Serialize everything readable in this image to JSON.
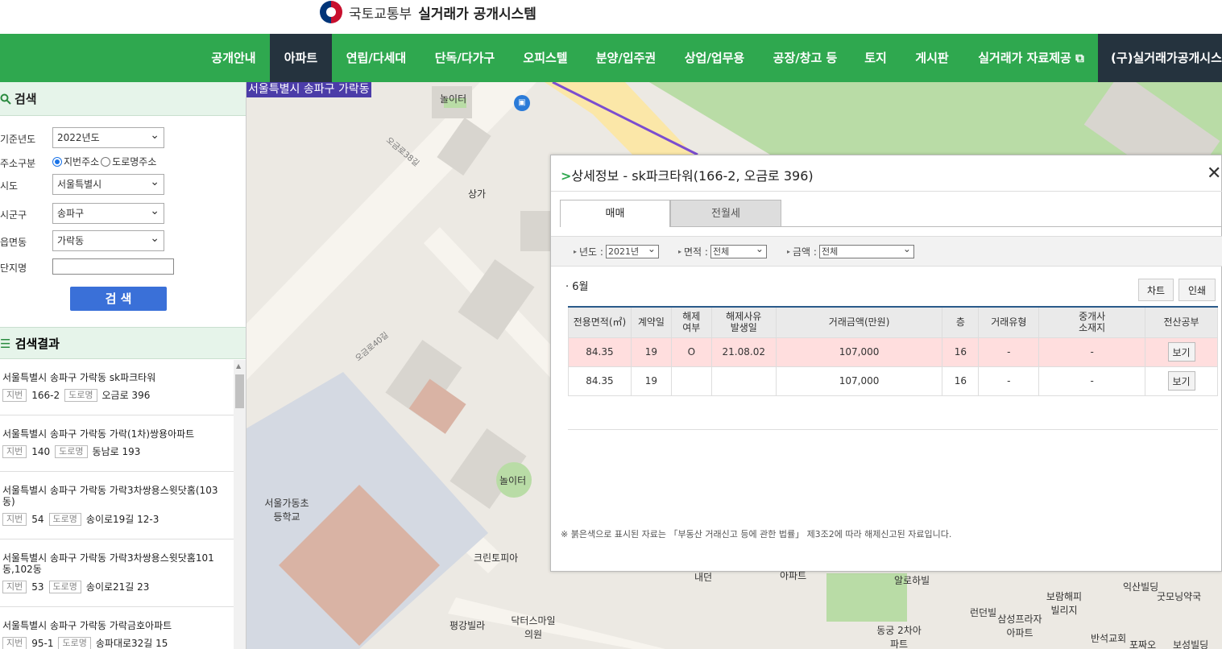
{
  "header": {
    "org": "국토교통부",
    "system": "실거래가 공개시스템"
  },
  "nav": {
    "items": [
      "공개안내",
      "아파트",
      "연립/다세대",
      "단독/다가구",
      "오피스텔",
      "분양/입주권",
      "상업/업무용",
      "공장/창고 등",
      "토지",
      "게시판",
      "실거래가 자료제공 ⧉",
      "(구)실거래가공개시스"
    ],
    "active": "아파트"
  },
  "sidebar": {
    "search_title": "검색",
    "fields": {
      "year_label": "기준년도",
      "year_value": "2022년도",
      "addr_type_label": "주소구분",
      "addr_opt1": "지번주소",
      "addr_opt2": "도로명주소",
      "sido_label": "시도",
      "sido_value": "서울특별시",
      "sigungu_label": "시군구",
      "sigungu_value": "송파구",
      "dong_label": "읍면동",
      "dong_value": "가락동",
      "complex_label": "단지명",
      "complex_value": ""
    },
    "search_button": "검 색",
    "results_title": "검색결과",
    "results": [
      {
        "name": "서울특별시 송파구 가락동 sk파크타워",
        "jibun_tag": "지번",
        "jibun": "166-2",
        "road_tag": "도로명",
        "road": "오금로 396"
      },
      {
        "name": "서울특별시 송파구 가락동 가락(1차)쌍용아파트",
        "jibun_tag": "지번",
        "jibun": "140",
        "road_tag": "도로명",
        "road": "동남로 193"
      },
      {
        "name": "서울특별시 송파구 가락동 가락3차쌍용스윗닷홈(103동)",
        "jibun_tag": "지번",
        "jibun": "54",
        "road_tag": "도로명",
        "road": "송이로19길 12-3"
      },
      {
        "name": "서울특별시 송파구 가락동 가락3차쌍용스윗닷홈101동,102동",
        "jibun_tag": "지번",
        "jibun": "53",
        "road_tag": "도로명",
        "road": "송이로21길 23"
      },
      {
        "name": "서울특별시 송파구 가락동 가락금호아파트",
        "jibun_tag": "지번",
        "jibun": "95-1",
        "road_tag": "도로명",
        "road": "송파대로32길 15"
      }
    ]
  },
  "map": {
    "address_overlay": "서울특별시 송파구 가락동",
    "labels": [
      "놀이터",
      "상가",
      "오금로38길",
      "오금로40길",
      "서울가동초등학교",
      "놀이터",
      "크린토피아",
      "평강빌라",
      "닥터스마일의원",
      "알로하빌",
      "런던빌",
      "삼성프라자아파트",
      "보람해피빌리지",
      "익산빌딩",
      "굿모닝약국",
      "반석교회",
      "포짜오",
      "보성빌딩",
      "내던",
      "아파트",
      "동궁 2차아파트"
    ]
  },
  "detail": {
    "title": "상세정보 - sk파크타워(166-2, 오금로 396)",
    "tabs": [
      "매매",
      "전월세"
    ],
    "filters": {
      "year_label": "년도 :",
      "year_value": "2021년",
      "area_label": "면적 :",
      "area_value": "전체",
      "price_label": "금액 :",
      "price_value": "전체"
    },
    "month": "· 6월",
    "chart_button": "차트",
    "print_button": "인쇄",
    "columns": [
      "전용면적(㎡)",
      "계약일",
      "해제\n여부",
      "해제사유\n발생일",
      "거래금액(만원)",
      "층",
      "거래유형",
      "중개사\n소재지",
      "전산공부"
    ],
    "rows": [
      {
        "area": "84.35",
        "day": "19",
        "cancel": "O",
        "cancel_date": "21.08.02",
        "price": "107,000",
        "floor": "16",
        "type": "-",
        "agent": "-",
        "doc": "보기"
      },
      {
        "area": "84.35",
        "day": "19",
        "cancel": "",
        "cancel_date": "",
        "price": "107,000",
        "floor": "16",
        "type": "-",
        "agent": "-",
        "doc": "보기"
      }
    ],
    "note": "※ 붉은색으로 표시된 자료는 「부동산 거래신고 등에 관한 법률」 제3조2에 따라 해제신고된 자료입니다."
  }
}
